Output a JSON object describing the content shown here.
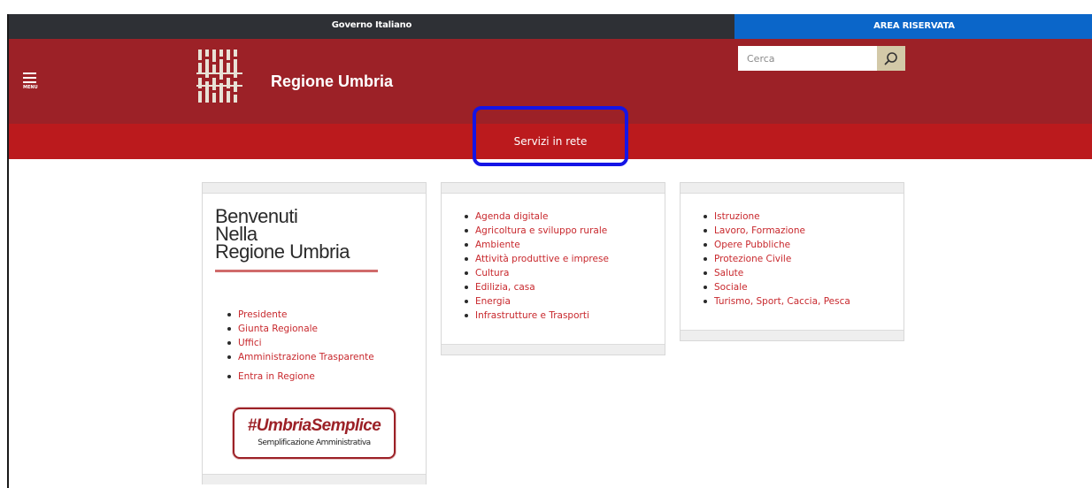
{
  "top_bar": {
    "gov_label": "Governo Italiano",
    "area_riservata": "AREA RISERVATA"
  },
  "header": {
    "menu_label": "MENU",
    "site_title": "Regione Umbria",
    "search_placeholder": "Cerca"
  },
  "nav": {
    "item": "Servizi in rete"
  },
  "welcome": {
    "line1": "Benvenuti",
    "line2": "Nella",
    "line3": "Regione Umbria"
  },
  "col1_links": [
    "Presidente",
    "Giunta Regionale",
    "Uffici",
    "Amministrazione Trasparente"
  ],
  "col1_extra_link": "Entra in Regione",
  "badge": {
    "title": "#UmbriaSemplice",
    "subtitle": "Semplificazione Amministrativa"
  },
  "col2_links": [
    "Agenda digitale",
    "Agricoltura e sviluppo rurale",
    "Ambiente",
    "Attività produttive e imprese",
    "Cultura",
    "Edilizia, casa",
    "Energia",
    "Infrastrutture e Trasporti"
  ],
  "col3_links": [
    "Istruzione",
    "Lavoro, Formazione",
    "Opere Pubbliche",
    "Protezione Civile",
    "Salute",
    "Sociale",
    "Turismo, Sport, Caccia, Pesca"
  ],
  "colors": {
    "header_bg": "#9c2127",
    "nav_bg": "#bb1a1d",
    "area_riservata_bg": "#0b66c9",
    "gov_bar_bg": "#2e3035",
    "link": "#c8282d"
  },
  "icons": {
    "menu": "hamburger-icon",
    "search": "search-icon",
    "logo": "regione-umbria-logo"
  }
}
